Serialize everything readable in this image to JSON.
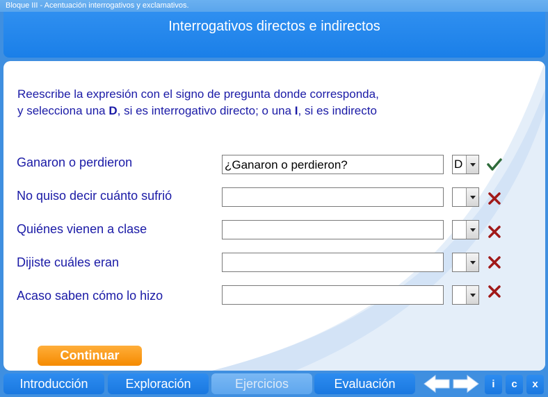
{
  "header": {
    "breadcrumb": "Bloque III  - Acentuación interrogativos y exclamativos.",
    "title": "Interrogativos directos e indirectos"
  },
  "instructions": {
    "line1": "Reescribe la expresión con el signo de pregunta donde corresponda,",
    "line2_a": "y selecciona una ",
    "line2_b": "D",
    "line2_c": ", si es interrogativo directo; o una ",
    "line2_d": "I",
    "line2_e": ", si es indirecto"
  },
  "rows": [
    {
      "label": "Ganaron o perdieron",
      "answer": "¿Ganaron o perdieron?",
      "choice": "D",
      "status": "correct"
    },
    {
      "label": "No quiso decir cuánto sufrió",
      "answer": "",
      "choice": "",
      "status": "incorrect"
    },
    {
      "label": "Quiénes vienen a clase",
      "answer": "",
      "choice": "",
      "status": "incorrect"
    },
    {
      "label": "Dijiste cuáles eran",
      "answer": "",
      "choice": "",
      "status": "incorrect"
    },
    {
      "label": "Acaso saben cómo lo hizo",
      "answer": "",
      "choice": "",
      "status": "incorrect"
    }
  ],
  "continue_label": "Continuar",
  "nav": {
    "tabs": [
      "Introducción",
      "Exploración",
      "Ejercicios",
      "Evaluación"
    ],
    "active_tab": "Ejercicios",
    "info_label": "i",
    "credits_label": "c",
    "close_label": "x"
  },
  "colors": {
    "background": "#3f8fe0",
    "text_blue": "#1a1aa6",
    "correct": "#2e6b3a",
    "incorrect": "#a01818",
    "continue": "#f58a00"
  },
  "icons": {
    "correct": "checkmark-icon",
    "incorrect": "x-mark-icon",
    "back": "arrow-left-icon",
    "forward": "arrow-right-icon"
  }
}
